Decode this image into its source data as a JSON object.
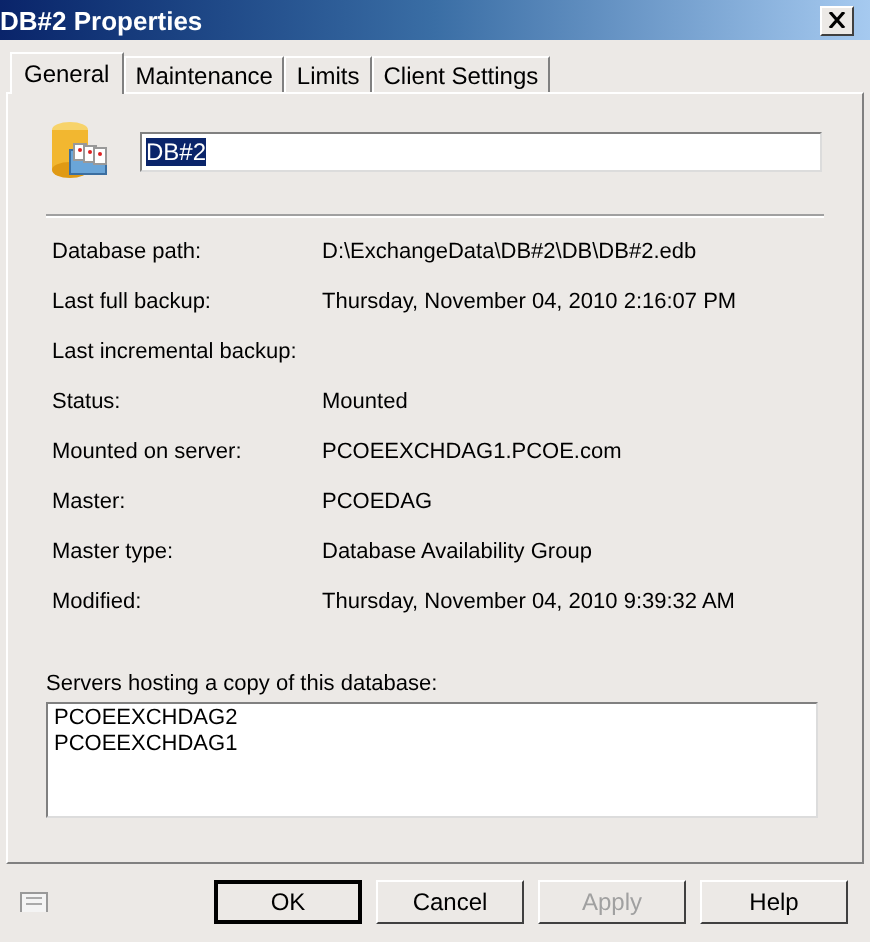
{
  "window": {
    "title": "DB#2 Properties"
  },
  "tabs": [
    {
      "label": "General",
      "selected": true
    },
    {
      "label": "Maintenance",
      "selected": false
    },
    {
      "label": "Limits",
      "selected": false
    },
    {
      "label": "Client Settings",
      "selected": false
    }
  ],
  "name_field": {
    "value": "DB#2"
  },
  "properties": [
    {
      "label": "Database path:",
      "value": "D:\\ExchangeData\\DB#2\\DB\\DB#2.edb"
    },
    {
      "label": "Last full backup:",
      "value": "Thursday, November 04, 2010 2:16:07 PM"
    },
    {
      "label": "Last incremental backup:"
    },
    {
      "label": "Status:",
      "value": "Mounted"
    },
    {
      "label": "Mounted on server:",
      "value": "PCOEEXCHDAG1.PCOE.com"
    },
    {
      "label": "Master:",
      "value": "PCOEDAG"
    },
    {
      "label": "Master type:",
      "value": "Database Availability Group"
    },
    {
      "label": "Modified:",
      "value": "Thursday, November 04, 2010 9:39:32 AM"
    }
  ],
  "servers": {
    "label": "Servers hosting a copy of this database:",
    "items": [
      "PCOEEXCHDAG2",
      "PCOEEXCHDAG1"
    ]
  },
  "buttons": [
    {
      "label": "OK",
      "disabled": false,
      "default": true
    },
    {
      "label": "Cancel",
      "disabled": false,
      "default": false
    },
    {
      "label": "Apply",
      "disabled": true,
      "default": false
    },
    {
      "label": "Help",
      "disabled": false,
      "default": false
    }
  ]
}
